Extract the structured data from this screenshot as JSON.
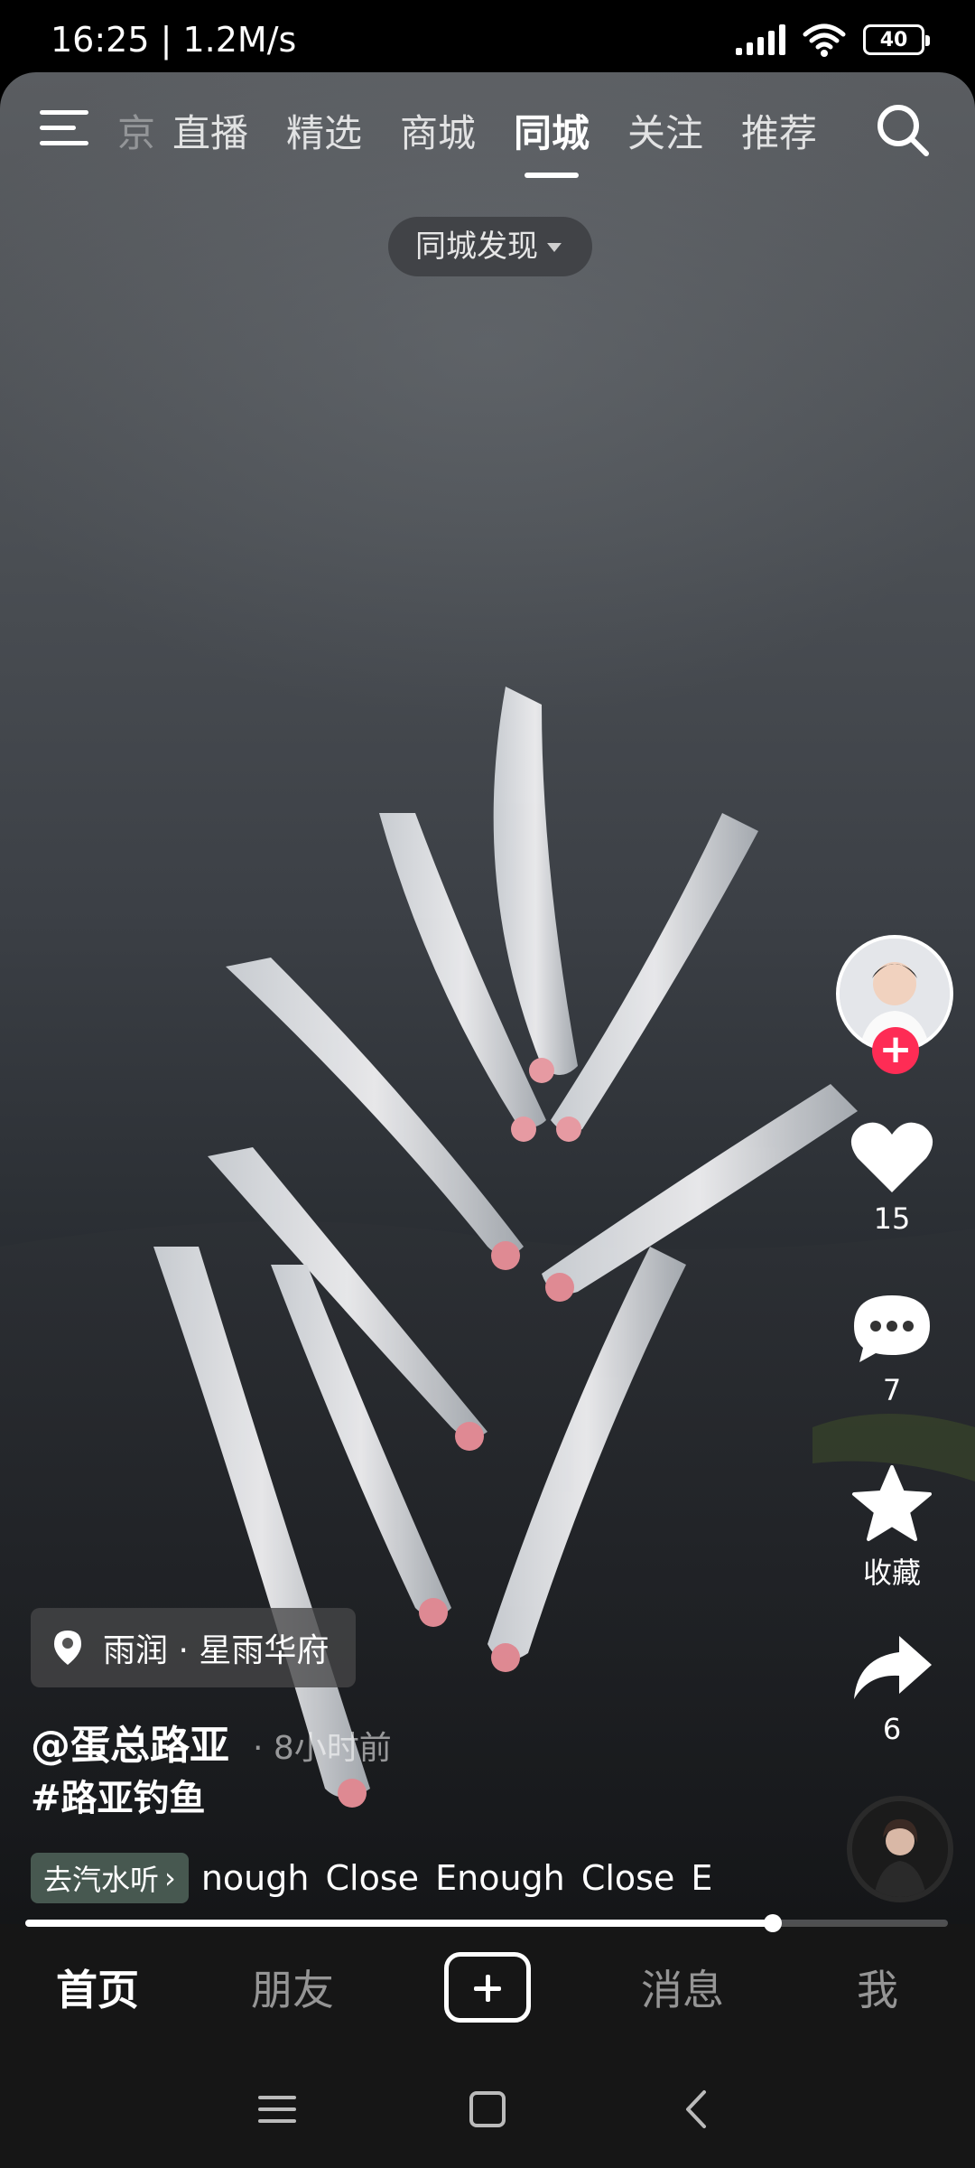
{
  "status_bar": {
    "time": "16:25 | 1.2M/s",
    "battery": "40"
  },
  "top_nav": {
    "tabs": [
      "京",
      "直播",
      "精选",
      "商城",
      "同城",
      "关注",
      "推荐"
    ],
    "active_tab": "同城"
  },
  "discover_pill": "同城发现",
  "actions": {
    "like_count": "15",
    "comment_count": "7",
    "favorite_label": "收藏",
    "share_count": "6"
  },
  "location": "雨润 · 星雨华府",
  "author": {
    "name": "@蛋总路亚",
    "time_ago": "· 8小时前"
  },
  "hashtag": "#路亚钓鱼",
  "music": {
    "listen_label": "去汽水听",
    "title": "nough   Close Enough   Close E"
  },
  "progress": 0.81,
  "bottom_tabs": [
    "首页",
    "朋友",
    "消息",
    "我"
  ]
}
